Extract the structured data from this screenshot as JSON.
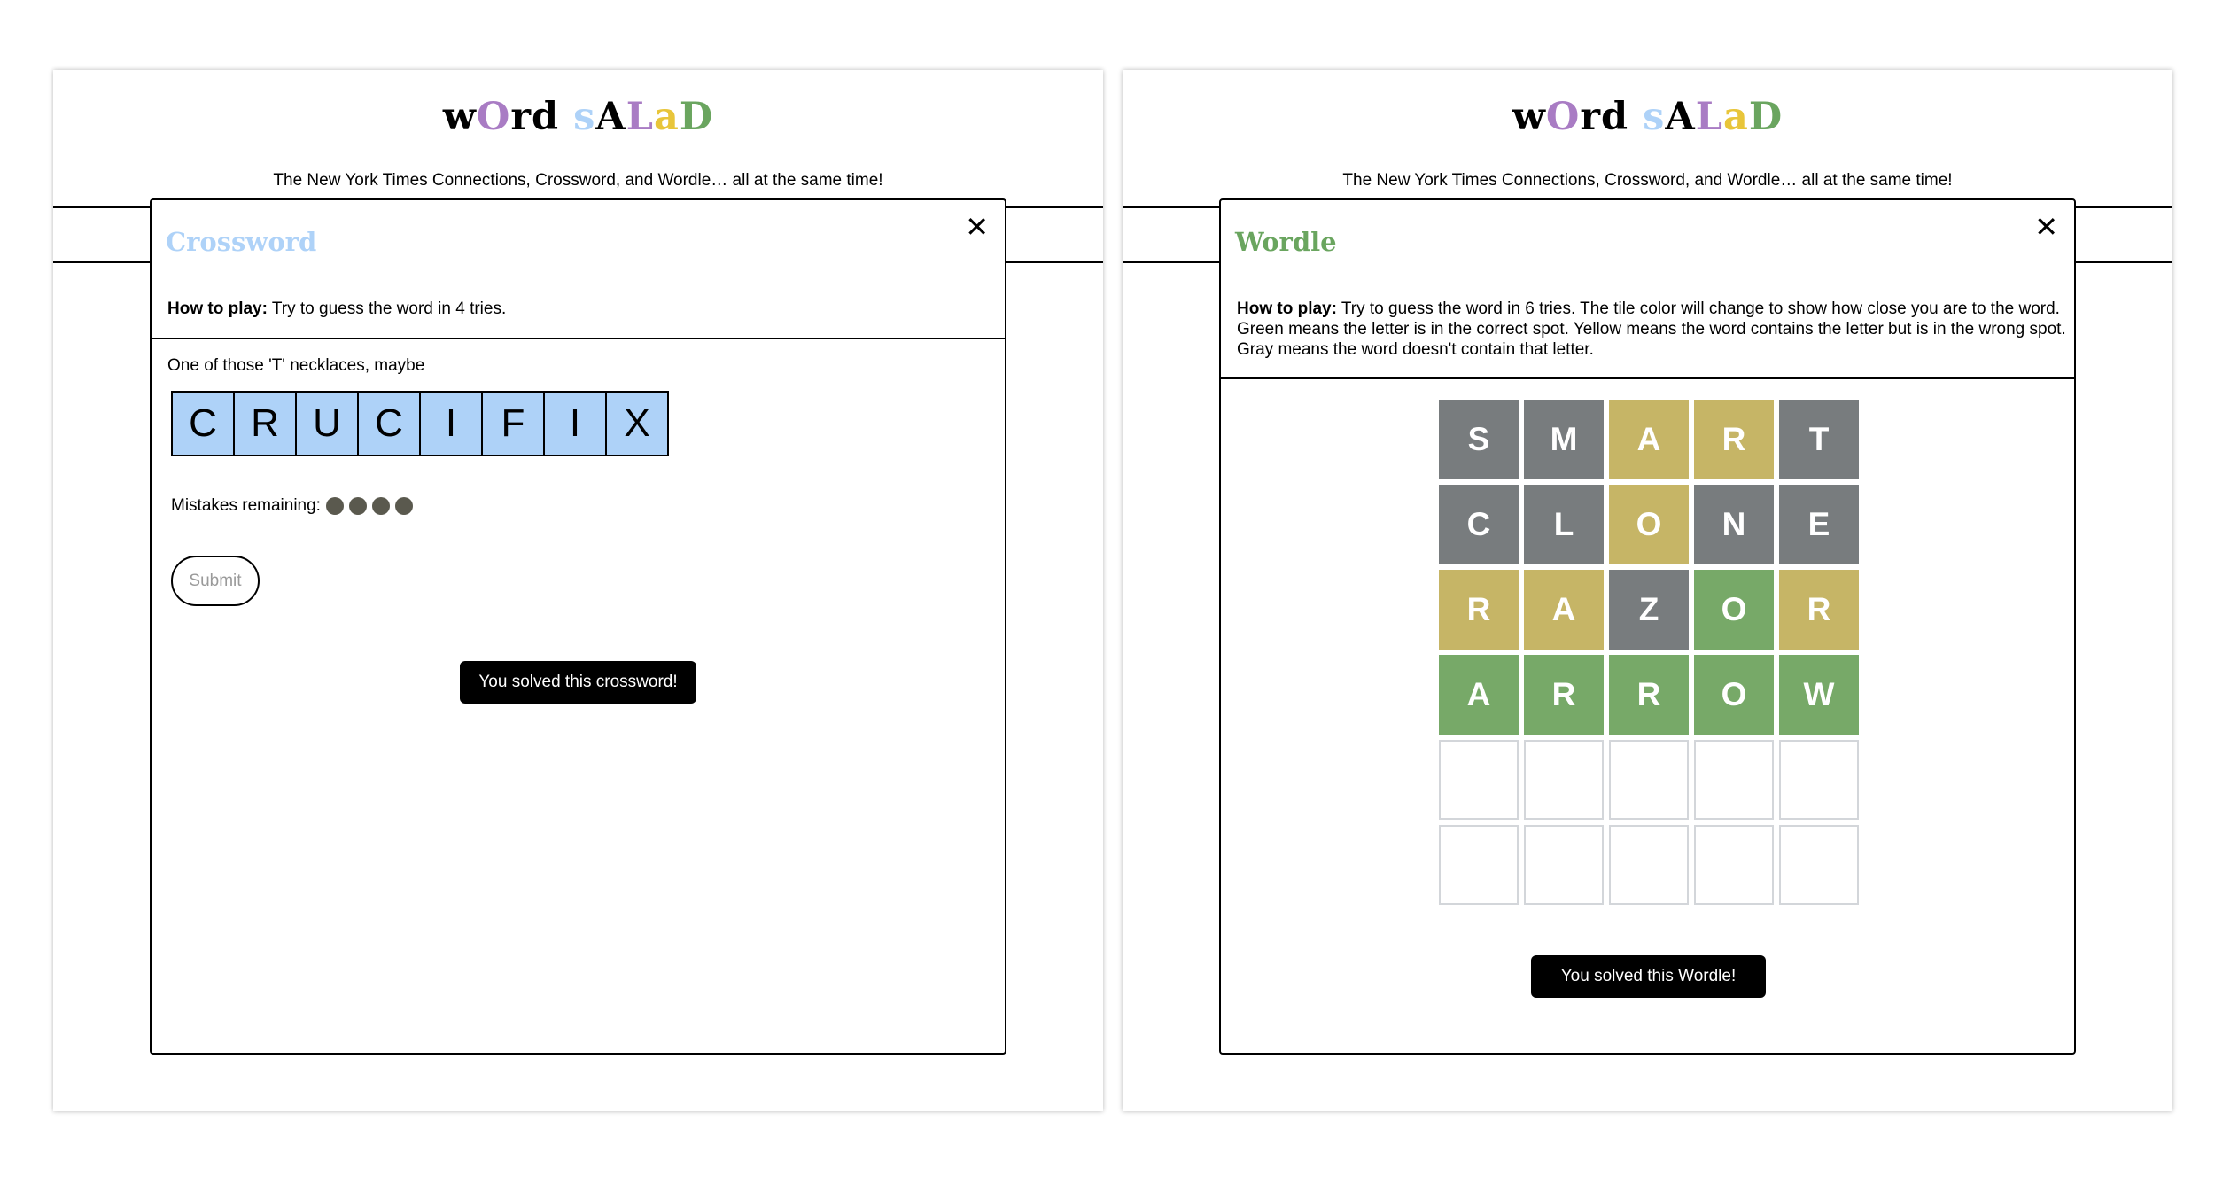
{
  "colors": {
    "crossword_title": "#aed2f8",
    "wordle_title": "#6aa55f",
    "crossword_cell": "#aed2f8",
    "tile_gray": "#787c7e",
    "tile_yellow": "#c6b566",
    "tile_green": "#77a968",
    "mistake_dot": "#5a594e"
  },
  "logo": {
    "letters": [
      {
        "ch": "w",
        "color": "#000000"
      },
      {
        "ch": "O",
        "color": "#a97cc4"
      },
      {
        "ch": "r",
        "color": "#000000"
      },
      {
        "ch": "d",
        "color": "#000000"
      },
      {
        "ch": " ",
        "color": "#000000"
      },
      {
        "ch": "s",
        "color": "#aed2f8"
      },
      {
        "ch": "A",
        "color": "#000000"
      },
      {
        "ch": "L",
        "color": "#a97cc4"
      },
      {
        "ch": "a",
        "color": "#e8c53a"
      },
      {
        "ch": "D",
        "color": "#6aa55f"
      }
    ]
  },
  "tagline": "The New York Times Connections, Crossword, and Wordle… all at the same time!",
  "crossword": {
    "title": "Crossword",
    "close": "✕",
    "howto_bold": "How to play:",
    "howto_text": " Try to guess the word in 4 tries.",
    "clue": "One of those 'T' necklaces, maybe",
    "letters": [
      "C",
      "R",
      "U",
      "C",
      "I",
      "F",
      "I",
      "X"
    ],
    "mistakes_label": "Mistakes remaining:",
    "mistakes_remaining": 4,
    "submit_label": "Submit",
    "solved_message": "You solved this crossword!"
  },
  "wordle": {
    "title": "Wordle",
    "close": "✕",
    "howto_bold": "How to play:",
    "howto_text": " Try to guess the word in 6 tries. The tile color will change to show how close you are to the word. Green means the letter is in the correct spot. Yellow means the word contains the letter but is in the wrong spot. Gray means the word doesn't contain that letter.",
    "rows": [
      [
        {
          "l": "S",
          "s": "gray"
        },
        {
          "l": "M",
          "s": "gray"
        },
        {
          "l": "A",
          "s": "yellow"
        },
        {
          "l": "R",
          "s": "yellow"
        },
        {
          "l": "T",
          "s": "gray"
        }
      ],
      [
        {
          "l": "C",
          "s": "gray"
        },
        {
          "l": "L",
          "s": "gray"
        },
        {
          "l": "O",
          "s": "yellow"
        },
        {
          "l": "N",
          "s": "gray"
        },
        {
          "l": "E",
          "s": "gray"
        }
      ],
      [
        {
          "l": "R",
          "s": "yellow"
        },
        {
          "l": "A",
          "s": "yellow"
        },
        {
          "l": "Z",
          "s": "gray"
        },
        {
          "l": "O",
          "s": "green"
        },
        {
          "l": "R",
          "s": "yellow"
        }
      ],
      [
        {
          "l": "A",
          "s": "green"
        },
        {
          "l": "R",
          "s": "green"
        },
        {
          "l": "R",
          "s": "green"
        },
        {
          "l": "O",
          "s": "green"
        },
        {
          "l": "W",
          "s": "green"
        }
      ],
      [
        {
          "l": "",
          "s": "empty"
        },
        {
          "l": "",
          "s": "empty"
        },
        {
          "l": "",
          "s": "empty"
        },
        {
          "l": "",
          "s": "empty"
        },
        {
          "l": "",
          "s": "empty"
        }
      ],
      [
        {
          "l": "",
          "s": "empty"
        },
        {
          "l": "",
          "s": "empty"
        },
        {
          "l": "",
          "s": "empty"
        },
        {
          "l": "",
          "s": "empty"
        },
        {
          "l": "",
          "s": "empty"
        }
      ]
    ],
    "solved_message": "You solved this Wordle!"
  }
}
